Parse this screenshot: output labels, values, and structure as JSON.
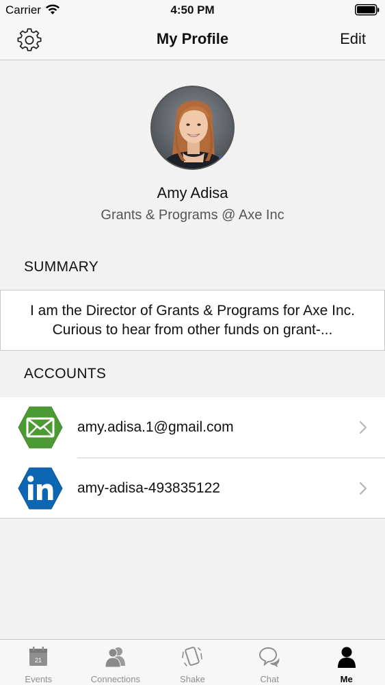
{
  "status_bar": {
    "carrier": "Carrier",
    "time": "4:50 PM"
  },
  "nav": {
    "title": "My Profile",
    "edit_label": "Edit",
    "settings_icon": "gear-icon"
  },
  "profile": {
    "name": "Amy Adisa",
    "title": "Grants & Programs @ Axe Inc"
  },
  "summary": {
    "header": "SUMMARY",
    "text": "I am the Director of Grants & Programs for Axe Inc. Curious to hear from other funds on grant-..."
  },
  "accounts": {
    "header": "ACCOUNTS",
    "items": [
      {
        "label": "amy.adisa.1@gmail.com",
        "icon": "email-icon",
        "color": "#4c9a34"
      },
      {
        "label": "amy-adisa-493835122",
        "icon": "linkedin-icon",
        "color": "#0c66b2"
      }
    ]
  },
  "tab_bar": {
    "tabs": [
      {
        "label": "Events",
        "icon": "calendar-icon",
        "icon_text": "21"
      },
      {
        "label": "Connections",
        "icon": "people-icon"
      },
      {
        "label": "Shake",
        "icon": "shake-phone-icon"
      },
      {
        "label": "Chat",
        "icon": "chat-icon"
      },
      {
        "label": "Me",
        "icon": "person-icon",
        "active": true
      }
    ]
  }
}
